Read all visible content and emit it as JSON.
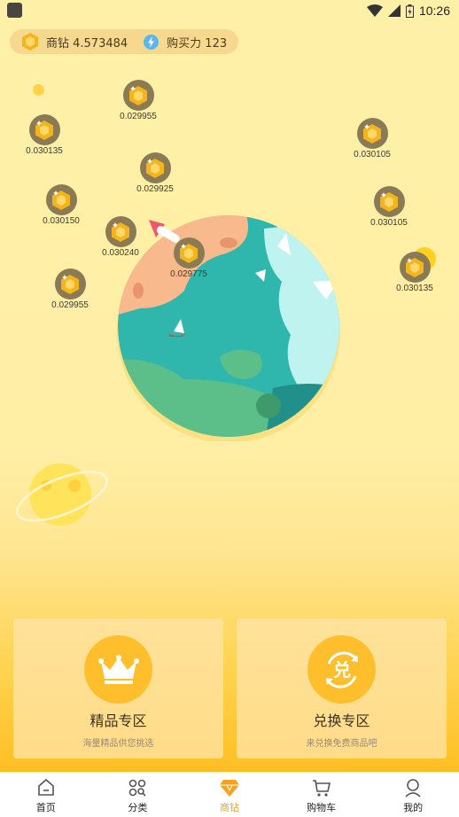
{
  "status_bar": {
    "time": "10:26"
  },
  "balance": {
    "diamond_label": "商钻 4.573484",
    "purchasing_label": "购买力 123"
  },
  "gems": [
    {
      "value": "0.029955"
    },
    {
      "value": "0.030135"
    },
    {
      "value": "0.029925"
    },
    {
      "value": "0.030150"
    },
    {
      "value": "0.030240"
    },
    {
      "value": "0.029775"
    },
    {
      "value": "0.029955"
    },
    {
      "value": "0.030105"
    },
    {
      "value": "0.030105"
    },
    {
      "value": "0.030135"
    }
  ],
  "cards": [
    {
      "title": "精品专区",
      "subtitle": "海量精品供您挑选",
      "icon": "crown-icon"
    },
    {
      "title": "兑换专区",
      "subtitle": "来兑换免费商品吧",
      "icon_text": "兑",
      "icon": "exchange-icon"
    }
  ],
  "tabs": [
    {
      "label": "首页",
      "icon": "home-icon"
    },
    {
      "label": "分类",
      "icon": "category-icon"
    },
    {
      "label": "商钻",
      "icon": "diamond-icon",
      "active": true
    },
    {
      "label": "购物车",
      "icon": "cart-icon"
    },
    {
      "label": "我的",
      "icon": "user-icon"
    }
  ],
  "colors": {
    "accent": "#f8a21d",
    "card_icon_bg": "#ffbf2d",
    "gem_bg": "#8a7a55",
    "pill_bg": "#f6d98f"
  }
}
